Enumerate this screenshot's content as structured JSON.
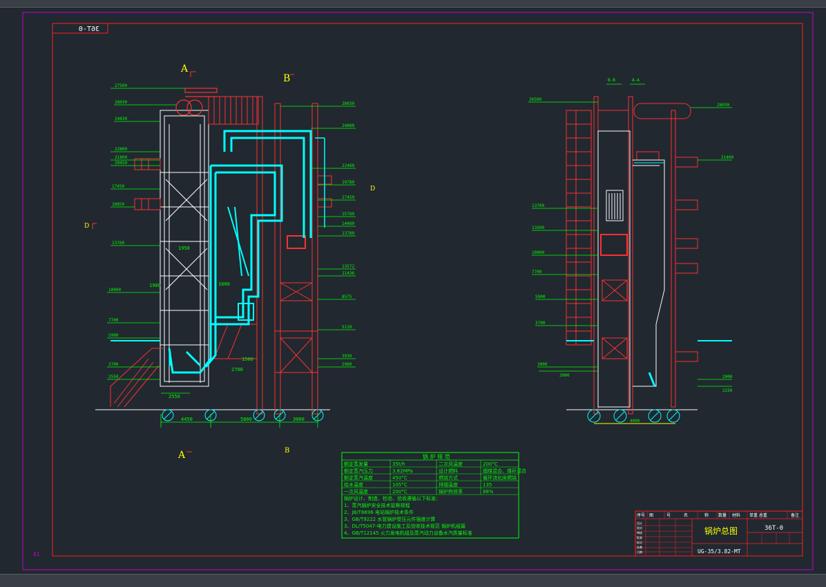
{
  "sheet": {
    "corner_code": "36T-0",
    "size_mark": "A1",
    "colors": {
      "background": "#212830",
      "sheet_border": "#c800c8",
      "frame": "#ff2020",
      "structure": "#ffffff",
      "duct": "#00ffff",
      "dims": "#00ff00",
      "steel": "#ff3030",
      "accent": "#ffff00"
    }
  },
  "front_view": {
    "section_markers": {
      "a_top": "A",
      "b_top": "B",
      "a_bottom": "A",
      "b_bottom": "B",
      "d_left": "D",
      "d_right": "D"
    },
    "left_elevations": [
      "27500",
      "28030",
      "24830",
      "22800",
      "21800",
      "20450",
      "17450",
      "16850",
      "13760",
      "10000",
      "7700",
      "5900",
      "3700",
      "2550"
    ],
    "right_elevations": [
      "28030",
      "24880",
      "22480",
      "19780",
      "17450",
      "15780",
      "14480",
      "13780",
      "13572",
      "11436",
      "8575",
      "5120",
      "3930",
      "2960"
    ],
    "bottom_dims": [
      "4450",
      "5800",
      "3000"
    ],
    "notes": [
      "2550",
      "1500",
      "2700",
      "1900",
      "1600",
      "1950"
    ]
  },
  "side_view": {
    "left_elevations": [
      "26500",
      "13700",
      "13500",
      "10000",
      "7700",
      "5900",
      "3700",
      "3000",
      "2000"
    ],
    "right_elevations": [
      "28030",
      "21400",
      "2900",
      "2250"
    ],
    "tags": [
      "B-B",
      "A-A"
    ],
    "bottom_dim": "4000"
  },
  "parameter_table": {
    "title": "锅 炉 规 范",
    "rows": [
      [
        "额定蒸发量",
        "35t/h",
        "二次风温度",
        "200°C"
      ],
      [
        "额定蒸汽压力",
        "3.82MPa",
        "设计燃料",
        "烟煤混合、煤矸混合"
      ],
      [
        "额定蒸汽温度",
        "450°C",
        "燃烧方式",
        "循环流化床燃烧"
      ],
      [
        "给水温度",
        "105°C",
        "排烟温度",
        "135"
      ],
      [
        "一次风温度",
        "200°C",
        "锅炉热效率",
        "88%"
      ]
    ],
    "notes": [
      "锅炉设计、制造、检验、验收遵循以下标准：",
      "1、蒸汽锅炉安全技术监察规程",
      "2、JB/T6696  电站锅炉技术条件",
      "3、GB/T9222  水管锅炉受压元件强度计算",
      "3、DL/T5047-电力建设施工及验收技术规范 锅炉机组篇",
      "4、GB/T12145  火力发电机组及蒸汽动力设备水汽质量标准"
    ]
  },
  "title_block": {
    "header": [
      "序号",
      "图",
      "号",
      "名",
      "称",
      "数量",
      "材料",
      "单重 总重",
      "备注"
    ],
    "drawing_title": "锅炉总图",
    "drawing_number": "36T-0",
    "model": "UG-35/3.82-MT",
    "small_labels": [
      "设计",
      "校对",
      "审核",
      "批准",
      "标记",
      "处数",
      "日期"
    ]
  }
}
